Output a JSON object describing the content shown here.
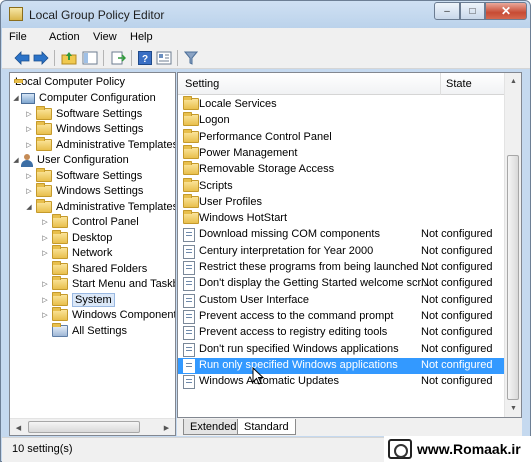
{
  "window": {
    "title": "Local Group Policy Editor"
  },
  "window_controls": {
    "minimize": "–",
    "maximize": "□",
    "close": "✕"
  },
  "menu": [
    "File",
    "Action",
    "View",
    "Help"
  ],
  "toolbar": {
    "back_icon": "back-arrow-icon",
    "forward_icon": "forward-arrow-icon",
    "up_icon": "up-folder-icon",
    "show_hide_icon": "console-tree-icon",
    "export_icon": "export-list-icon",
    "help_icon": "help-icon",
    "properties_icon": "properties-icon",
    "filter_icon": "filter-icon"
  },
  "tree": {
    "root": "Local Computer Policy",
    "computer_configuration": "Computer Configuration",
    "cc_software_settings": "Software Settings",
    "cc_windows_settings": "Windows Settings",
    "cc_admin_templates": "Administrative Templates",
    "user_configuration": "User Configuration",
    "uc_software_settings": "Software Settings",
    "uc_windows_settings": "Windows Settings",
    "uc_admin_templates": "Administrative Templates",
    "control_panel": "Control Panel",
    "desktop": "Desktop",
    "network": "Network",
    "shared_folders": "Shared Folders",
    "start_menu": "Start Menu and Taskba",
    "system": "System",
    "windows_components": "Windows Components",
    "all_settings": "All Settings"
  },
  "list": {
    "col_setting": "Setting",
    "col_state": "State",
    "folders": [
      "Locale Services",
      "Logon",
      "Performance Control Panel",
      "Power Management",
      "Removable Storage Access",
      "Scripts",
      "User Profiles",
      "Windows HotStart"
    ],
    "policies": [
      {
        "name": "Download missing COM components",
        "state": "Not configured"
      },
      {
        "name": "Century interpretation for Year 2000",
        "state": "Not configured"
      },
      {
        "name": "Restrict these programs from being launched ...",
        "state": "Not configured"
      },
      {
        "name": "Don't display the Getting Started welcome scr...",
        "state": "Not configured"
      },
      {
        "name": "Custom User Interface",
        "state": "Not configured"
      },
      {
        "name": "Prevent access to the command prompt",
        "state": "Not configured"
      },
      {
        "name": "Prevent access to registry editing tools",
        "state": "Not configured"
      },
      {
        "name": "Don't run specified Windows applications",
        "state": "Not configured"
      },
      {
        "name": "Run only specified Windows applications",
        "state": "Not configured"
      },
      {
        "name": "Windows Automatic Updates",
        "state": "Not configured"
      }
    ]
  },
  "tabs": {
    "extended": "Extended",
    "standard": "Standard"
  },
  "status": {
    "text": "10 setting(s)"
  },
  "watermark": {
    "text": "www.Romaak.ir"
  }
}
